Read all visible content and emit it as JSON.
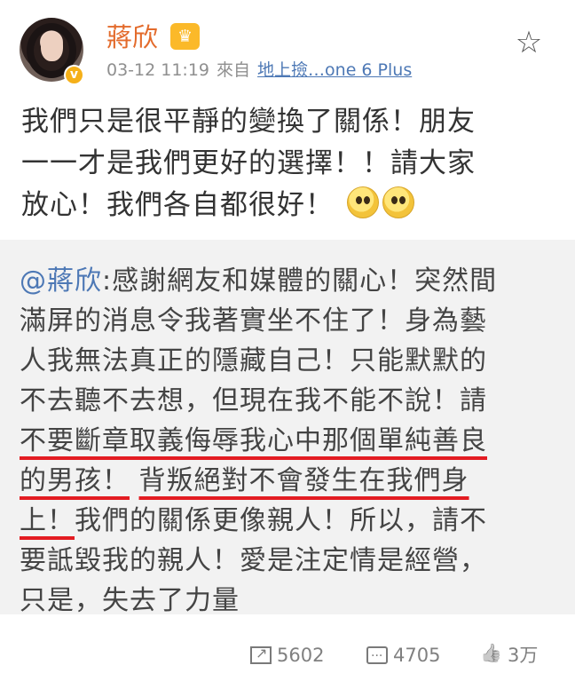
{
  "post": {
    "username": "蔣欣",
    "crown_icon": "crown-icon",
    "verified_icon": "verified-badge-icon",
    "timestamp": "03-12 11:19",
    "source_prefix": "來自",
    "source": "地上撿…one 6 Plus",
    "text_lines": [
      "我們只是很平靜的變換了關係！朋友",
      "一一才是我們更好的選擇！！請大家",
      "放心！我們各自都很好！"
    ]
  },
  "repost": {
    "mention": "@蔣欣",
    "lines": [
      "感謝網友和媒體的關心！突然間",
      "滿屏的消息令我著實坐不住了！身為藝",
      "人我無法真正的隱藏自己！只能默默的",
      "不去聽不去想，但現在我不能不說！請",
      "不要斷章取義侮辱我心中那個單純善良",
      "的男孩！",
      "背叛絕對不會發生在我們身",
      "上！",
      "我們的關係更像親人！所以，請不",
      "要詆毀我的親人！愛是注定情是經營，",
      "只是，失去了力量"
    ],
    "underline_color": "#e31c22"
  },
  "footer": {
    "repost_count": "5602",
    "comment_count": "4705",
    "like_count": "3万"
  },
  "colors": {
    "username": "#e36b2c",
    "link": "#4d78b5",
    "repost_background": "#f2f2f2"
  }
}
